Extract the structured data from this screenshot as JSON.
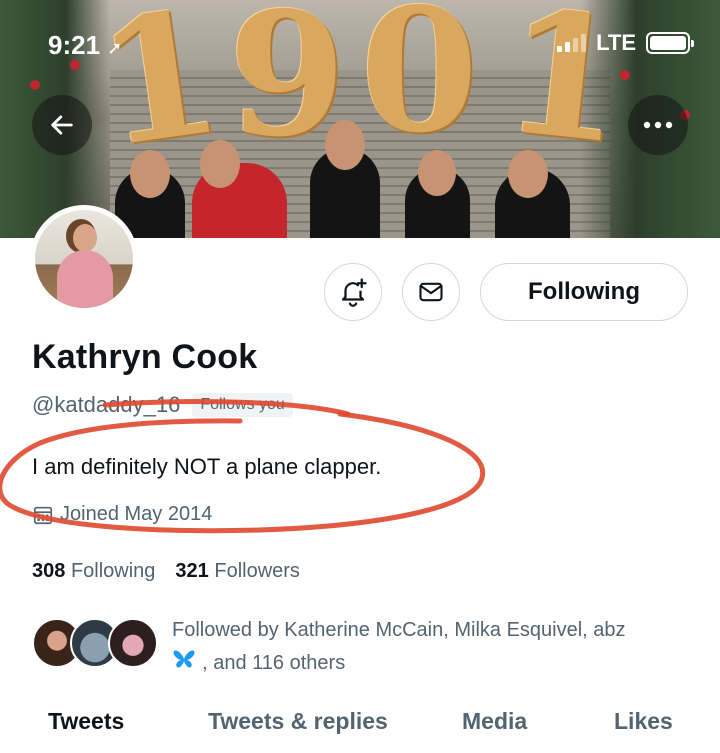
{
  "status": {
    "time": "9:21",
    "carrier": "LTE"
  },
  "banner": {
    "numbers": [
      "1",
      "9",
      "0",
      "1"
    ]
  },
  "profile": {
    "name": "Kathryn Cook",
    "handle": "@katdaddy_16",
    "follows_you": "Follows you",
    "bio": "I am definitely NOT a plane clapper.",
    "joined": "Joined May 2014",
    "following_count": "308",
    "following_label": "Following",
    "followers_count": "321",
    "followers_label": "Followers"
  },
  "actions": {
    "following_label": "Following"
  },
  "followed_by": {
    "line1": "Followed by Katherine McCain, Milka Esquivel, abz",
    "line2": ", and 116 others"
  },
  "tabs": [
    "Tweets",
    "Tweets & replies",
    "Media",
    "Likes"
  ],
  "colors": {
    "annotation": "#e0482f",
    "muted": "#536471"
  },
  "icons": [
    "back-arrow-icon",
    "more-icon",
    "notification-bell-plus-icon",
    "mail-icon",
    "calendar-icon",
    "butterfly-icon"
  ]
}
